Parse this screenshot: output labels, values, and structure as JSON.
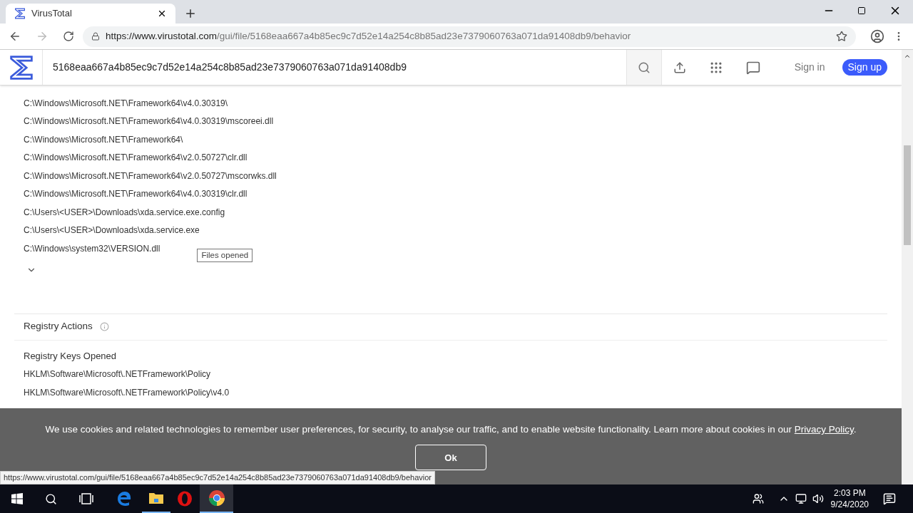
{
  "browser": {
    "tab_title": "VirusTotal",
    "url_host": "https://www.virustotal.com",
    "url_path": "/gui/file/5168eaa667a4b85ec9c7d52e14a254c8b85ad23e7379060763a071da91408db9/behavior"
  },
  "header": {
    "search_value": "5168eaa667a4b85ec9c7d52e14a254c8b85ad23e7379060763a071da91408db9",
    "sign_in": "Sign in",
    "sign_up": "Sign up"
  },
  "files": [
    "C:\\Windows\\Microsoft.NET\\Framework64\\v4.0.30319\\",
    "C:\\Windows\\Microsoft.NET\\Framework64\\v4.0.30319\\mscoreei.dll",
    "C:\\Windows\\Microsoft.NET\\Framework64\\",
    "C:\\Windows\\Microsoft.NET\\Framework64\\v2.0.50727\\clr.dll",
    "C:\\Windows\\Microsoft.NET\\Framework64\\v2.0.50727\\mscorwks.dll",
    "C:\\Windows\\Microsoft.NET\\Framework64\\v4.0.30319\\clr.dll",
    "C:\\Users\\<USER>\\Downloads\\xda.service.exe.config",
    "C:\\Users\\<USER>\\Downloads\\xda.service.exe",
    "C:\\Windows\\system32\\VERSION.dll"
  ],
  "tooltip": "Files opened",
  "registry": {
    "title": "Registry Actions",
    "subtitle": "Registry Keys Opened",
    "keys": [
      "HKLM\\Software\\Microsoft\\.NETFramework\\Policy",
      "HKLM\\Software\\Microsoft\\.NETFramework\\Policy\\v4.0"
    ]
  },
  "cookie": {
    "text": "We use cookies and related technologies to remember user preferences, for security, to analyse our traffic, and to enable website functionality. Learn more about cookies in our ",
    "link": "Privacy Policy",
    "end": ".",
    "button": "Ok"
  },
  "status_url": "https://www.virustotal.com/gui/file/5168eaa667a4b85ec9c7d52e14a254c8b85ad23e7379060763a071da91408db9/behavior",
  "clock": {
    "time": "2:03 PM",
    "date": "9/24/2020"
  }
}
